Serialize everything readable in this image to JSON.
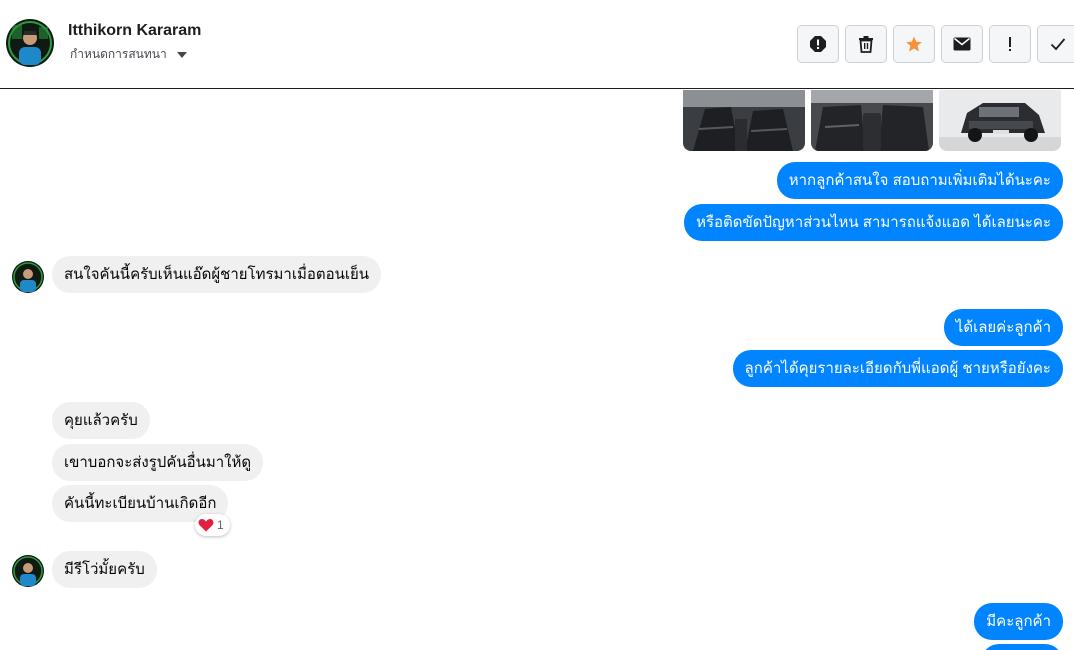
{
  "header": {
    "name": "Itthikorn Kararam",
    "subtitle": "กำหนดการสนทนา"
  },
  "toolbar": {
    "buttons": [
      "report-icon",
      "trash-icon",
      "star-icon",
      "mail-icon",
      "important-icon",
      "check-icon"
    ],
    "star_color": "#f7923b"
  },
  "messages": {
    "out1": "หากลูกค้าสนใจ สอบถามเพิ่มเติมได้นะคะ",
    "out2": "หรือติดขัดปัญหาส่วนไหน สามารถแจ้งแอด ได้เลยนะคะ",
    "in1": "สนใจคันนี้ครับเห็นแอ๊ดผู้ชายโทรมาเมื่อตอนเย็น",
    "out3": "ได้เลยค่ะลูกค้า",
    "out4": "ลูกค้าได้คุยรายละเอียดกับพี่แอดผู้ ชายหรือยังคะ",
    "in2": "คุยแล้วครับ",
    "in3": "เขาบอกจะส่งรูปคันอื่นมาให้ดู",
    "in4": "คันนี้ทะเบียนบ้านเกิดอีก",
    "reaction_count": "1",
    "in5": "มีรีโว่มั้ยครับ",
    "out5": "มีคะลูกค้า"
  },
  "colors": {
    "outgoing_bubble": "#0084ff",
    "incoming_bubble": "#f0f0f0",
    "heart": "#e41e3f"
  }
}
